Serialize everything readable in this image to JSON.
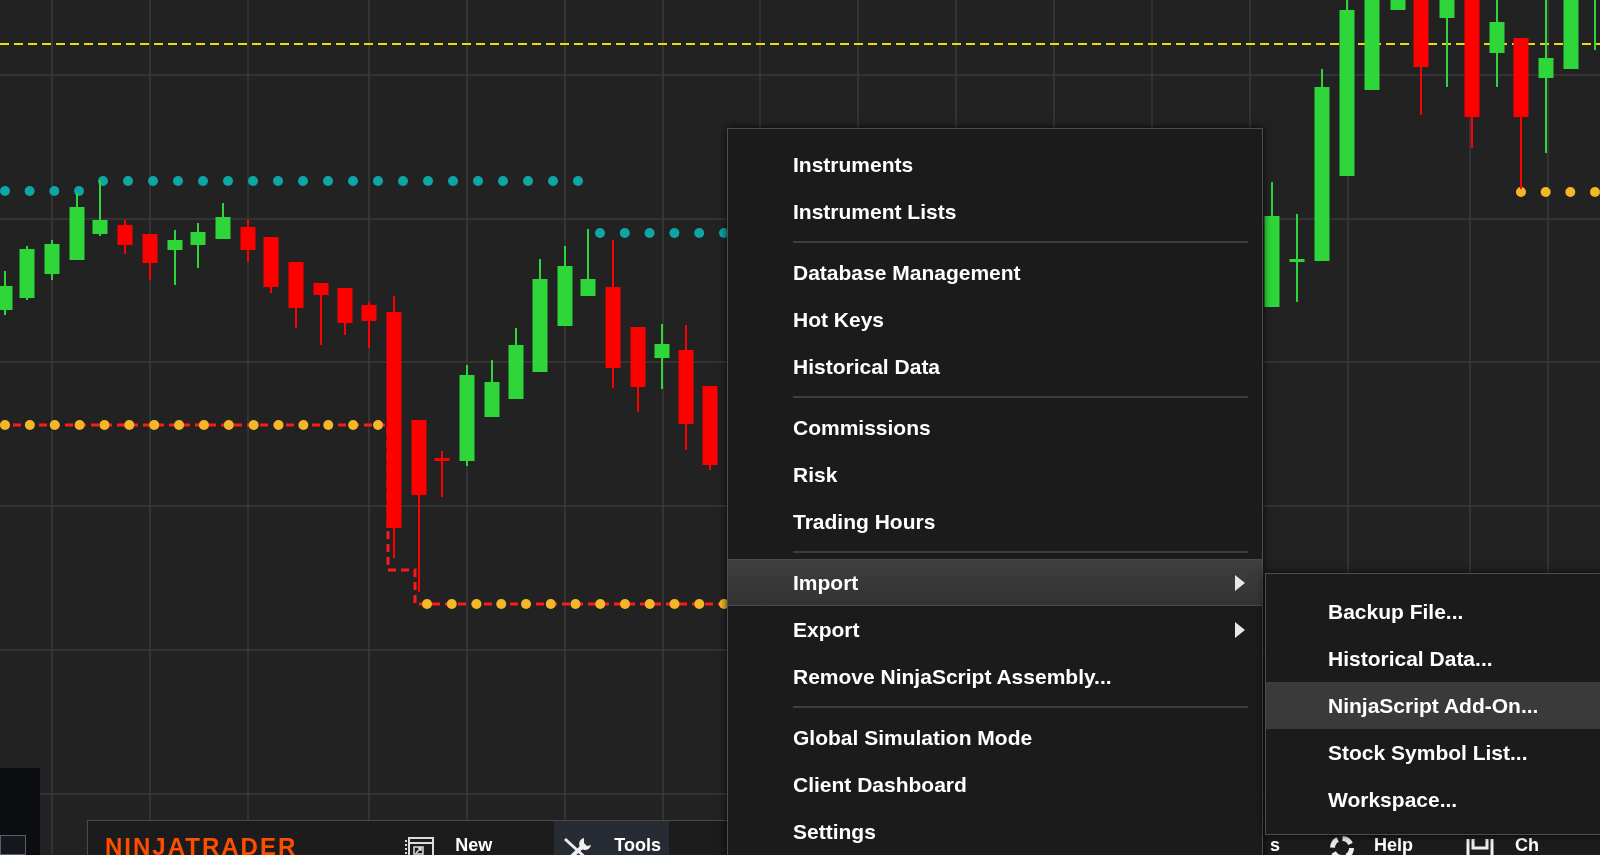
{
  "tools_menu": {
    "groups": [
      {
        "items": [
          {
            "label": "Instruments",
            "selected": false,
            "submenu": false
          },
          {
            "label": "Instrument Lists",
            "selected": false,
            "submenu": false
          }
        ]
      },
      {
        "items": [
          {
            "label": "Database Management",
            "selected": false,
            "submenu": false
          },
          {
            "label": "Hot Keys",
            "selected": false,
            "submenu": false
          },
          {
            "label": "Historical Data",
            "selected": false,
            "submenu": false
          }
        ]
      },
      {
        "items": [
          {
            "label": "Commissions",
            "selected": false,
            "submenu": false
          },
          {
            "label": "Risk",
            "selected": false,
            "submenu": false
          },
          {
            "label": "Trading Hours",
            "selected": false,
            "submenu": false
          }
        ]
      },
      {
        "items": [
          {
            "label": "Import",
            "selected": true,
            "submenu": true
          },
          {
            "label": "Export",
            "selected": false,
            "submenu": true
          },
          {
            "label": "Remove NinjaScript Assembly...",
            "selected": false,
            "submenu": false
          }
        ]
      },
      {
        "items": [
          {
            "label": "Global Simulation Mode",
            "selected": false,
            "submenu": false
          },
          {
            "label": "Client Dashboard",
            "selected": false,
            "submenu": false
          },
          {
            "label": "Settings",
            "selected": false,
            "submenu": false
          }
        ]
      }
    ]
  },
  "import_submenu": {
    "items": [
      {
        "label": "Backup File...",
        "selected": false
      },
      {
        "label": "Historical Data...",
        "selected": false
      },
      {
        "label": "NinjaScript Add-On...",
        "selected": true
      },
      {
        "label": "Stock Symbol List...",
        "selected": false
      },
      {
        "label": "Workspace...",
        "selected": false
      }
    ]
  },
  "control_center_bar": {
    "logo": "NINJATRADER",
    "items": [
      {
        "kind": "new",
        "label": "New",
        "selected": false
      },
      {
        "kind": "tools",
        "label": "Tools",
        "selected": true
      },
      {
        "kind": "text",
        "label": "s",
        "selected": false
      },
      {
        "kind": "help",
        "label": "Help",
        "selected": false
      },
      {
        "kind": "chart",
        "label": "Ch",
        "selected": false
      }
    ]
  }
}
